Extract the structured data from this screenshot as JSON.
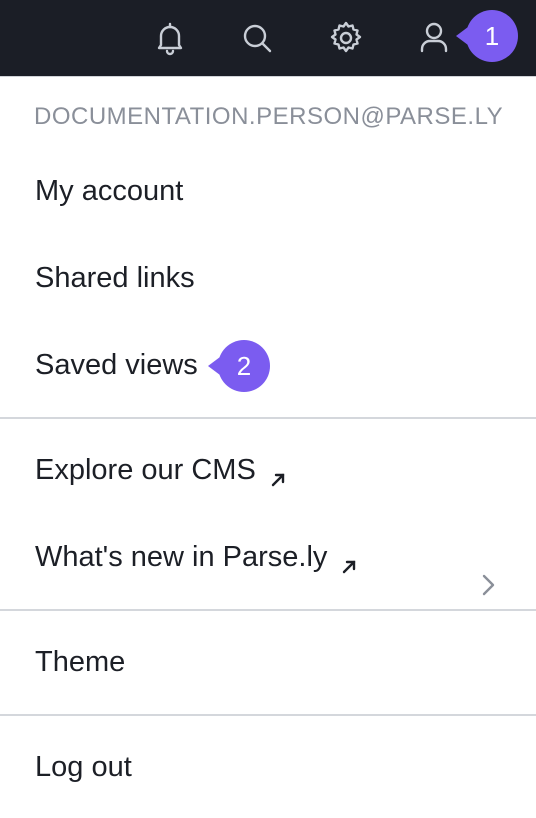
{
  "header": {
    "icons": [
      "bell-icon",
      "search-icon",
      "gear-icon",
      "user-icon"
    ],
    "background_color": "#1b1e26"
  },
  "annotations": {
    "badge_1": "1",
    "badge_2": "2",
    "badge_color": "#7b5cf0"
  },
  "menu": {
    "email": "DOCUMENTATION.PERSON@PARSE.LY",
    "my_account": "My account",
    "shared_links": "Shared links",
    "saved_views": "Saved views",
    "explore_cms": "Explore our CMS",
    "whats_new": "What's new in Parse.ly",
    "theme": "Theme",
    "log_out": "Log out"
  }
}
